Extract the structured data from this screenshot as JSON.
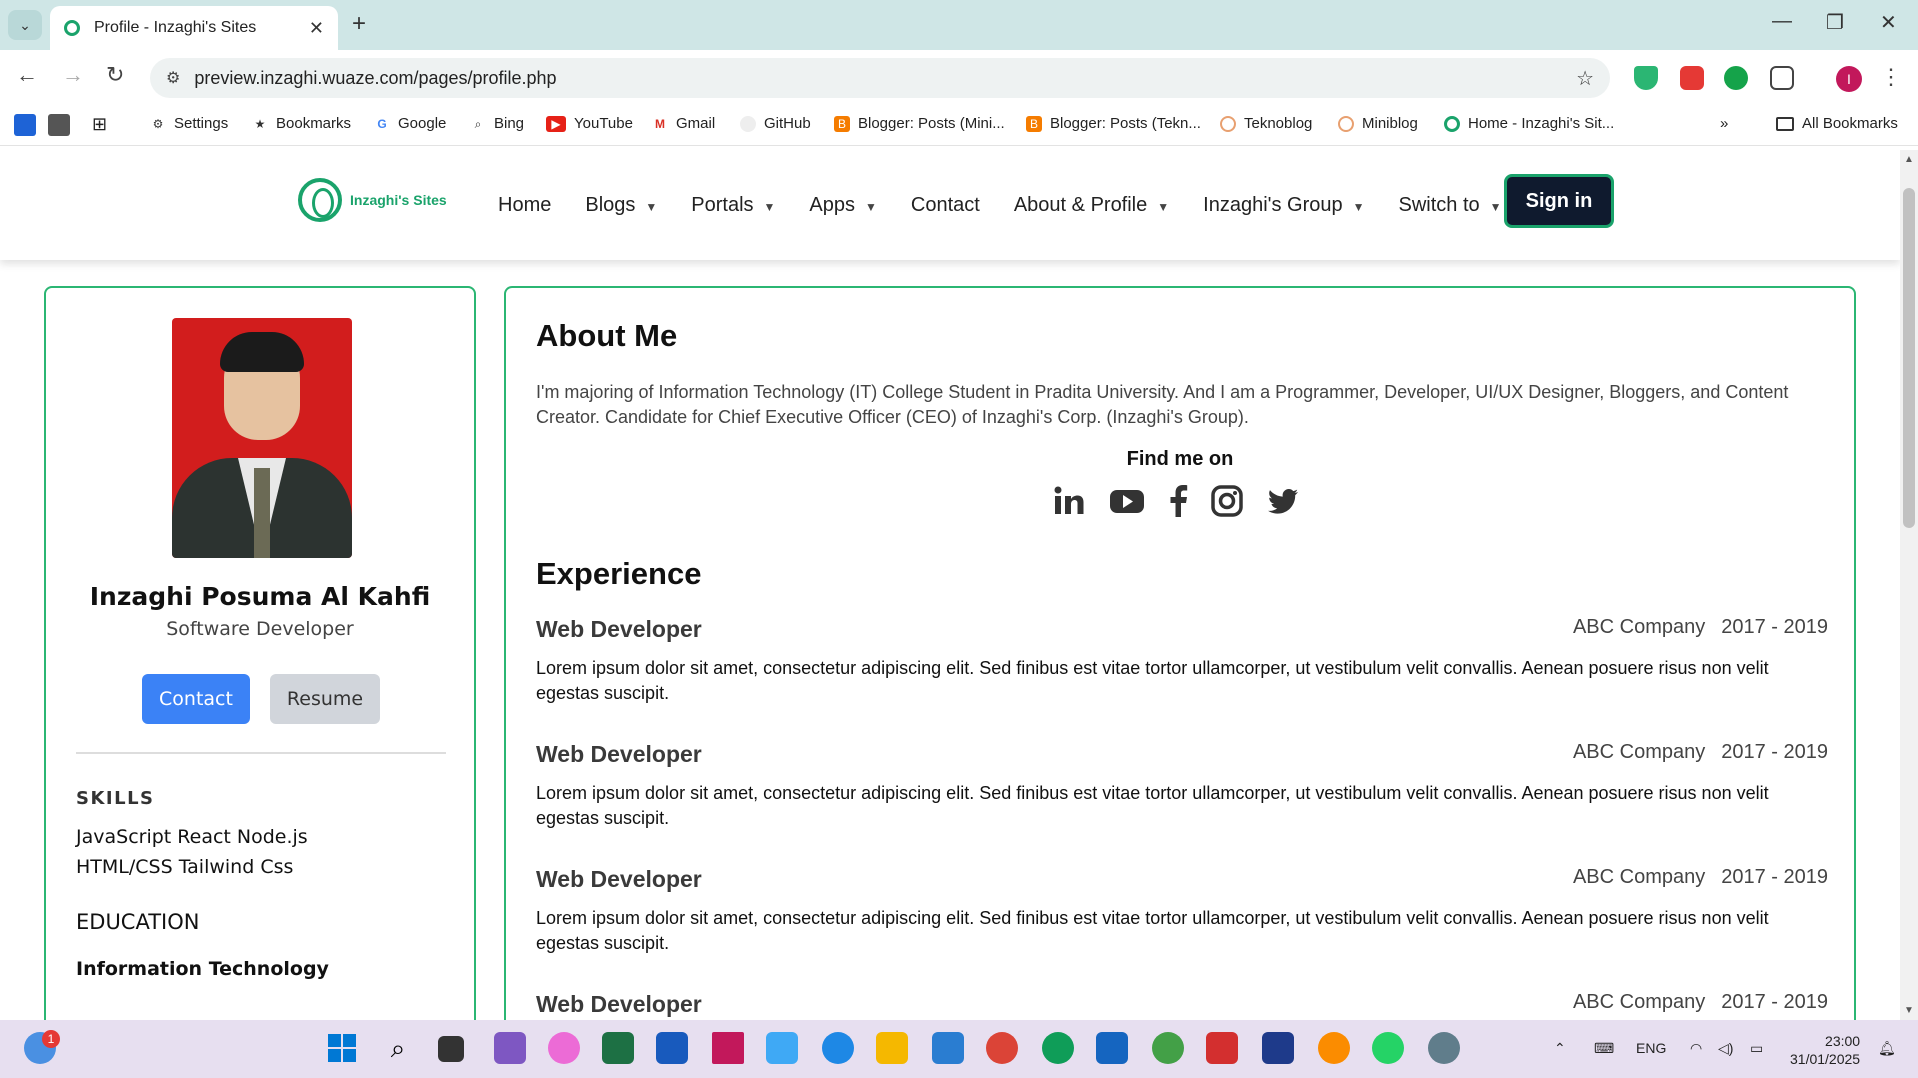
{
  "browser": {
    "tab_title": "Profile - Inzaghi's Sites",
    "url": "preview.inzaghi.wuaze.com/pages/profile.php",
    "bookmarks": [
      {
        "label": "Settings"
      },
      {
        "label": "Bookmarks"
      },
      {
        "label": "Google"
      },
      {
        "label": "Bing"
      },
      {
        "label": "YouTube"
      },
      {
        "label": "Gmail"
      },
      {
        "label": "GitHub"
      },
      {
        "label": "Blogger: Posts (Mini..."
      },
      {
        "label": "Blogger: Posts (Tekn..."
      },
      {
        "label": "Teknoblog"
      },
      {
        "label": "Miniblog"
      },
      {
        "label": "Home - Inzaghi's Sit..."
      }
    ],
    "all_bookmarks": "All Bookmarks",
    "profile_initial": "I"
  },
  "site": {
    "logo_text": "Inzaghi's Sites",
    "nav": [
      {
        "label": "Home"
      },
      {
        "label": "Blogs"
      },
      {
        "label": "Portals"
      },
      {
        "label": "Apps"
      },
      {
        "label": "Contact"
      },
      {
        "label": "About & Profile"
      },
      {
        "label": "Inzaghi's Group"
      },
      {
        "label": "Switch to"
      }
    ],
    "signin": "Sign in"
  },
  "profile": {
    "name": "Inzaghi Posuma Al Kahfi",
    "role": "Software Developer",
    "contact_btn": "Contact",
    "resume_btn": "Resume",
    "skills_heading": "SKILLS",
    "skills_text": "JavaScript React Node.js HTML/CSS Tailwind Css",
    "education_heading": "EDUCATION",
    "education_item": "Information Technology"
  },
  "about": {
    "heading": "About Me",
    "text": "I'm majoring of Information Technology (IT) College Student in Pradita University. And I am a Programmer, Developer, UI/UX Designer, Bloggers, and Content Creator. Candidate for Chief Executive Officer (CEO) of Inzaghi's Corp. (Inzaghi's Group).",
    "find_me": "Find me on",
    "socials": [
      "linkedin-icon",
      "youtube-icon",
      "facebook-icon",
      "instagram-icon",
      "twitter-icon"
    ]
  },
  "experience": {
    "heading": "Experience",
    "jobs": [
      {
        "title": "Web Developer",
        "company": "ABC Company",
        "period": "2017 - 2019",
        "desc": "Lorem ipsum dolor sit amet, consectetur adipiscing elit. Sed finibus est vitae tortor ullamcorper, ut vestibulum velit convallis. Aenean posuere risus non velit egestas suscipit."
      },
      {
        "title": "Web Developer",
        "company": "ABC Company",
        "period": "2017 - 2019",
        "desc": "Lorem ipsum dolor sit amet, consectetur adipiscing elit. Sed finibus est vitae tortor ullamcorper, ut vestibulum velit convallis. Aenean posuere risus non velit egestas suscipit."
      },
      {
        "title": "Web Developer",
        "company": "ABC Company",
        "period": "2017 - 2019",
        "desc": "Lorem ipsum dolor sit amet, consectetur adipiscing elit. Sed finibus est vitae tortor ullamcorper, ut vestibulum velit convallis. Aenean posuere risus non velit egestas suscipit."
      },
      {
        "title": "Web Developer",
        "company": "ABC Company",
        "period": "2017 - 2019",
        "desc": ""
      }
    ]
  },
  "taskbar": {
    "notification_badge": "1",
    "language": "ENG",
    "time": "23:00",
    "date": "31/01/2025"
  },
  "colors": {
    "accent_green": "#2bb673",
    "signin_bg": "#0f1a2e",
    "contact_blue": "#3b82f6"
  }
}
